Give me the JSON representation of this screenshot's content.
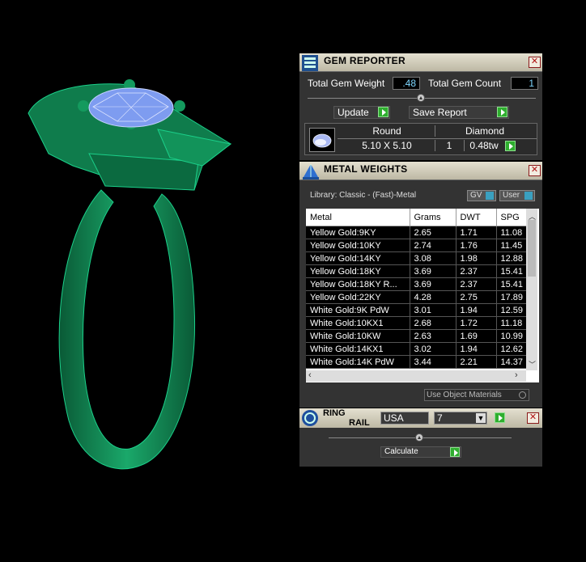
{
  "gem_reporter": {
    "title": "GEM REPORTER",
    "total_gem_weight_label": "Total Gem Weight",
    "total_gem_weight_value": ".48",
    "total_gem_count_label": "Total Gem Count",
    "total_gem_count_value": "1",
    "update_label": "Update",
    "save_report_label": "Save Report",
    "gem_row": {
      "shape": "Round",
      "material": "Diamond",
      "size": "5.10 X 5.10",
      "count": "1",
      "weight": "0.48tw"
    }
  },
  "metal_weights": {
    "title": "METAL WEIGHTS",
    "library_label": "Library: Classic - (Fast)-Metal",
    "gv_label": "GV",
    "user_label": "User",
    "columns": [
      "Metal",
      "Grams",
      "DWT",
      "SPG"
    ],
    "rows": [
      [
        "Yellow Gold:9KY",
        "2.65",
        "1.71",
        "11.08"
      ],
      [
        "Yellow Gold:10KY",
        "2.74",
        "1.76",
        "11.45"
      ],
      [
        "Yellow Gold:14KY",
        "3.08",
        "1.98",
        "12.88"
      ],
      [
        "Yellow Gold:18KY",
        "3.69",
        "2.37",
        "15.41"
      ],
      [
        "Yellow Gold:18KY R...",
        "3.69",
        "2.37",
        "15.41"
      ],
      [
        "Yellow Gold:22KY",
        "4.28",
        "2.75",
        "17.89"
      ],
      [
        "White Gold:9K PdW",
        "3.01",
        "1.94",
        "12.59"
      ],
      [
        "White Gold:10KX1",
        "2.68",
        "1.72",
        "11.18"
      ],
      [
        "White Gold:10KW",
        "2.63",
        "1.69",
        "10.99"
      ],
      [
        "White Gold:14KX1",
        "3.02",
        "1.94",
        "12.62"
      ],
      [
        "White Gold:14K PdW",
        "3.44",
        "2.21",
        "14.37"
      ]
    ],
    "use_object_materials_label": "Use Object Materials"
  },
  "ring_rail": {
    "title_line1": "RING",
    "title_line2": "RAIL",
    "standard_value": "USA",
    "size_value": "7",
    "calculate_label": "Calculate"
  },
  "colors": {
    "model_green": "#0f8a56",
    "gem_blue": "#7e9cf0",
    "panel_bg": "#333333",
    "title_bar": "#d6d2c2"
  },
  "icons": [
    "gem-reporter-icon",
    "metal-weights-icon",
    "ring-rail-icon",
    "close-icon",
    "go-arrow-icon",
    "chevron-down-icon"
  ]
}
